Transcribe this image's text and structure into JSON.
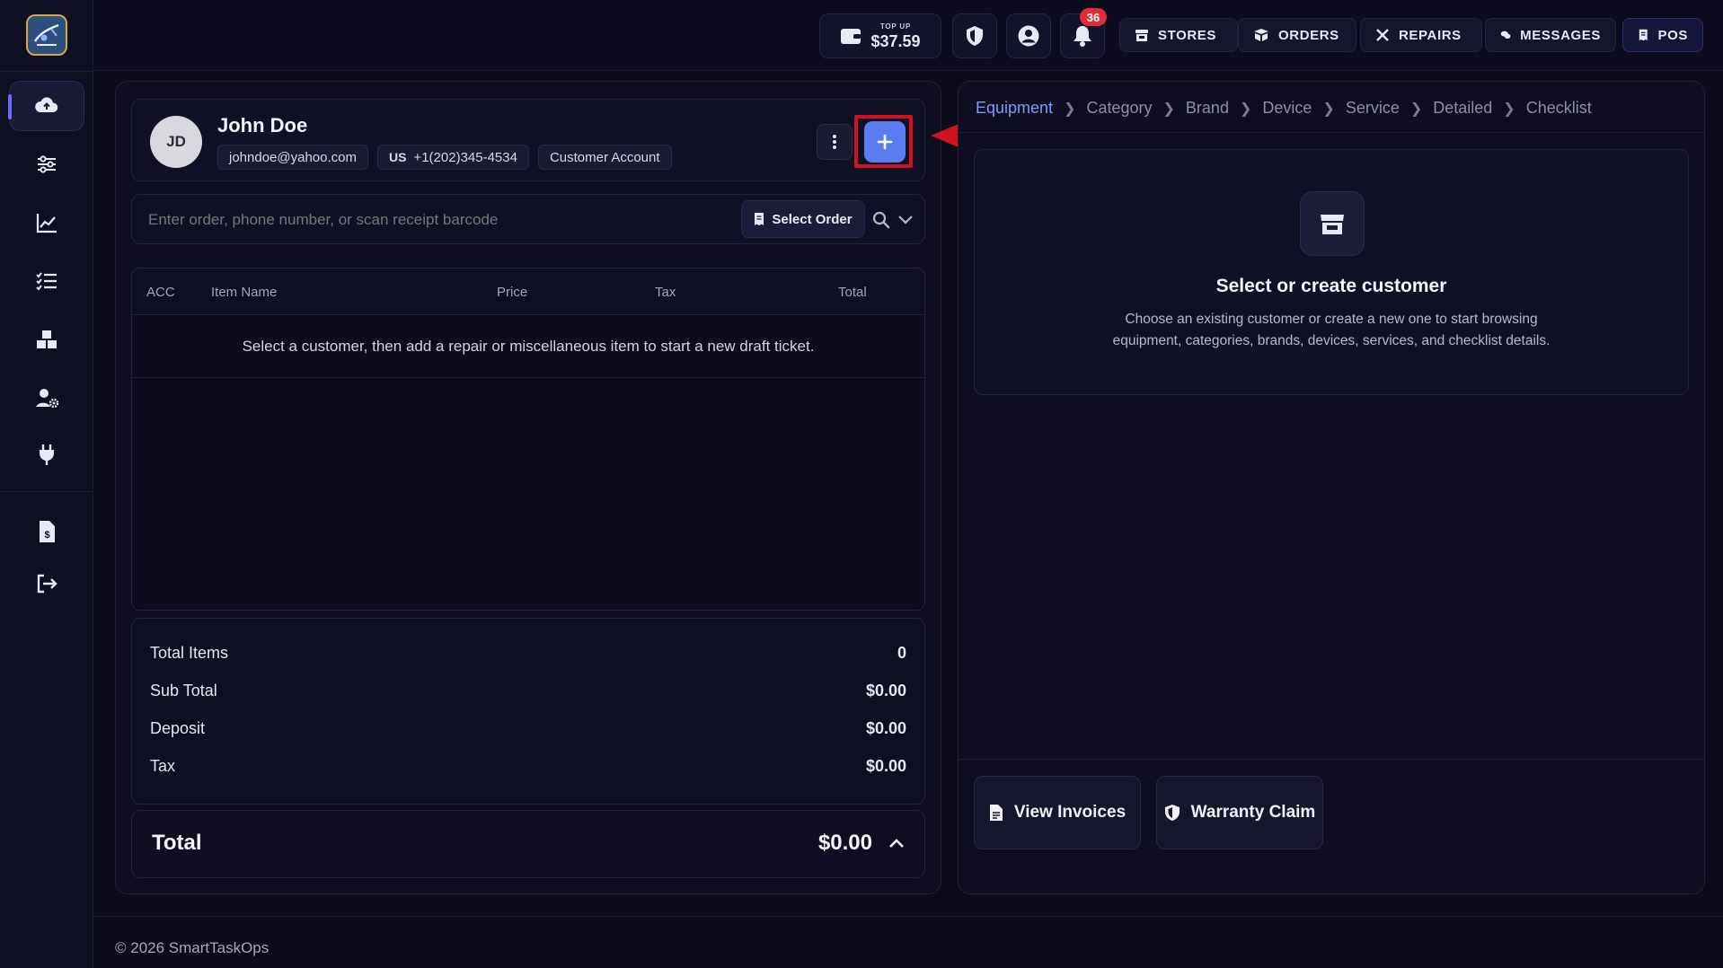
{
  "topbar": {
    "wallet_caption": "TOP UP",
    "wallet_amount": "$37.59",
    "notification_count": "36",
    "nav": [
      "STORES",
      "ORDERS",
      "REPAIRS",
      "MESSAGES",
      "POS"
    ]
  },
  "customer": {
    "initials": "JD",
    "name": "John Doe",
    "email": "johndoe@yahoo.com",
    "country": "US",
    "phone": "+1(202)345-4534",
    "account_type": "Customer Account"
  },
  "search": {
    "placeholder": "Enter order, phone number, or scan receipt barcode",
    "select_order_label": "Select Order"
  },
  "table": {
    "headers": [
      "ACC",
      "Item Name",
      "Price",
      "Tax",
      "Total"
    ],
    "empty_message": "Select a customer, then add a repair or miscellaneous item to start a new draft ticket."
  },
  "summary": {
    "rows": [
      {
        "label": "Total Items",
        "value": "0"
      },
      {
        "label": "Sub Total",
        "value": "$0.00"
      },
      {
        "label": "Deposit",
        "value": "$0.00"
      },
      {
        "label": "Tax",
        "value": "$0.00"
      }
    ],
    "total_label": "Total",
    "total_value": "$0.00"
  },
  "breadcrumb": [
    "Equipment",
    "Category",
    "Brand",
    "Device",
    "Service",
    "Detailed",
    "Checklist"
  ],
  "empty_state": {
    "title": "Select or create customer",
    "line1": "Choose an existing customer or create a new one to start browsing",
    "line2": "equipment, categories, brands, devices, services, and checklist details."
  },
  "actions": {
    "view_invoices": "View Invoices",
    "warranty_claim": "Warranty Claim"
  },
  "footer": "© 2026 SmartTaskOps",
  "colors": {
    "accent": "#5b7cf0",
    "annotation_red": "#d0121f",
    "badge_red": "#e02d3c",
    "background": "#0b0b1a"
  }
}
